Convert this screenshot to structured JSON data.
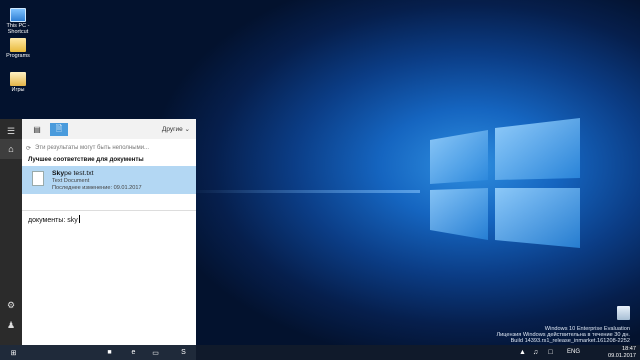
{
  "desktop": {
    "icons": [
      {
        "label": "This PC - Shortcut",
        "icon": "computer-icon"
      },
      {
        "label": "Programs",
        "icon": "folder-icon"
      },
      {
        "label": "Игры",
        "icon": "games-folder-icon"
      }
    ],
    "recycle_bin": {
      "icon": "recycle-bin-icon"
    },
    "watermark": {
      "line1": "Windows 10 Enterprise Evaluation",
      "line2": "Лицензия Windows действительна в течение 30 дн.",
      "line3": "Build 14393.rs1_release_inmarket.161208-2252"
    }
  },
  "search_panel": {
    "filter_more_label": "Другие",
    "notice": "Эти результаты могут быть неполными...",
    "section_title": "Лучшее соответствие для документы",
    "best_match": {
      "title_bold": "Sky",
      "title_rest": "pe test.txt",
      "type": "Text Document",
      "modified": "Последнее изменение: 09.01.2017"
    },
    "query": "документы: sky"
  },
  "taskbar": {
    "lang": "ENG",
    "time": "18:47",
    "date": "09.01.2017"
  },
  "colors": {
    "accent": "#4a9bdc",
    "selected_row": "#b3d7f3",
    "rail": "#2b2b2b"
  }
}
